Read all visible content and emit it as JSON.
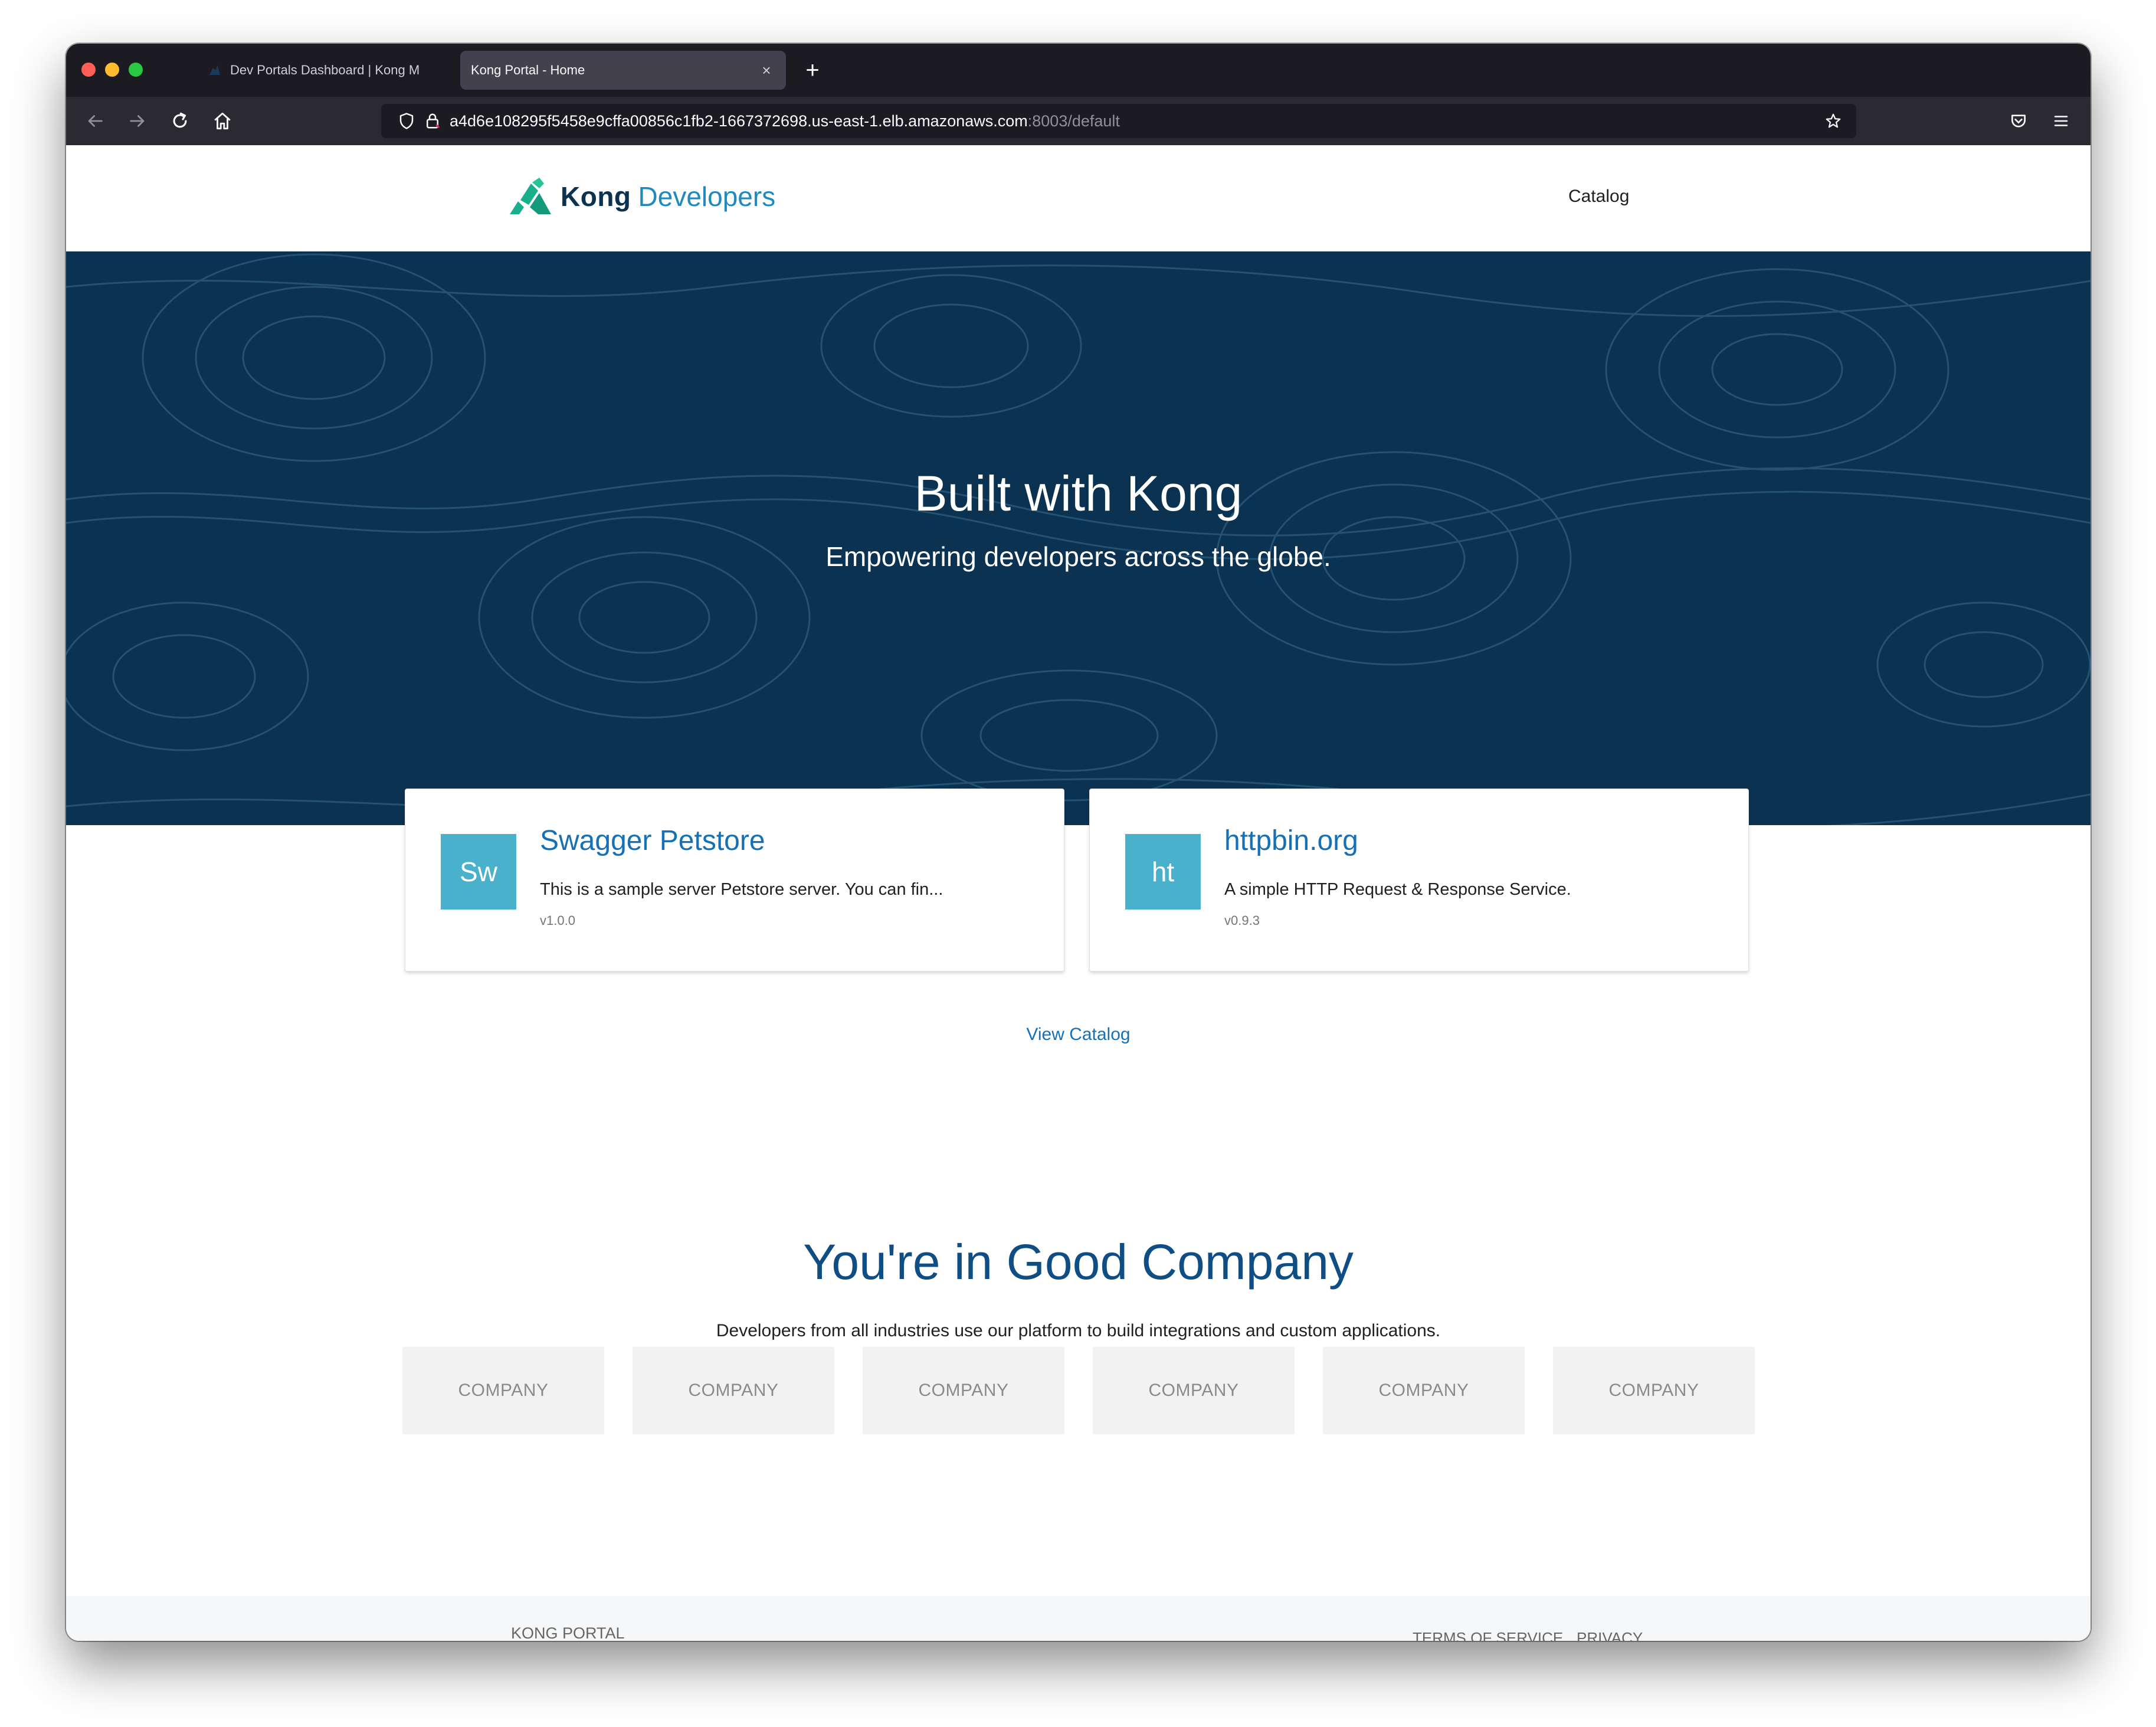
{
  "browser": {
    "tabs": [
      {
        "title": "Dev Portals Dashboard | Kong M",
        "active": false
      },
      {
        "title": "Kong Portal - Home",
        "active": true
      }
    ],
    "url_main": "a4d6e108295f5458e9cffa00856c1fb2-1667372698.us-east-1.elb.amazonaws.com",
    "url_dim": ":8003/default"
  },
  "header": {
    "logo_bold": "Kong",
    "logo_light": "Developers",
    "nav_catalog": "Catalog"
  },
  "hero": {
    "title": "Built with Kong",
    "subtitle": "Empowering developers across the globe."
  },
  "cards": [
    {
      "avatar": "Sw",
      "title": "Swagger Petstore",
      "description": "This is a sample server Petstore server. You can fin...",
      "version": "v1.0.0"
    },
    {
      "avatar": "ht",
      "title": "httpbin.org",
      "description": "A simple HTTP Request & Response Service.",
      "version": "v0.9.3"
    }
  ],
  "view_catalog": "View Catalog",
  "good_company": {
    "title": "You're in Good Company",
    "subtitle": "Developers from all industries use our platform to build integrations and custom applications.",
    "companies": [
      "COMPANY",
      "COMPANY",
      "COMPANY",
      "COMPANY",
      "COMPANY",
      "COMPANY"
    ]
  },
  "footer": {
    "brand": "KONG PORTAL",
    "links": [
      "TERMS OF SERVICE",
      "PRIVACY"
    ]
  },
  "colors": {
    "hero_bg": "#0b3250",
    "link_blue": "#1570b5",
    "avatar_teal": "#49b1cc",
    "heading_blue": "#0f4e84"
  },
  "icons": [
    "back-icon",
    "forward-icon",
    "reload-icon",
    "home-icon",
    "shield-icon",
    "lock-icon",
    "star-icon",
    "pocket-icon",
    "menu-icon",
    "plus-icon",
    "close-icon"
  ]
}
